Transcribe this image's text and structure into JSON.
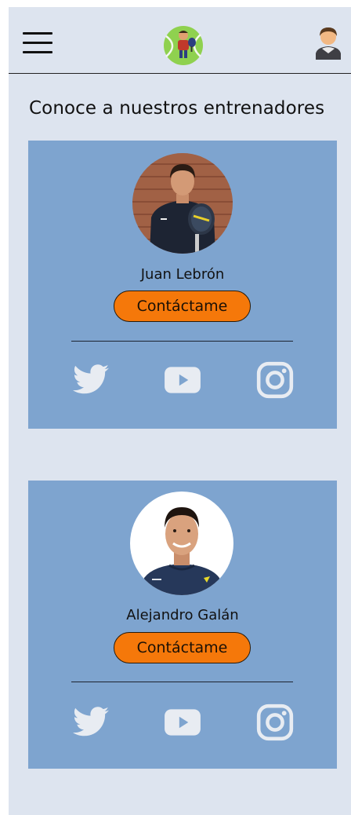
{
  "header": {
    "menu_icon": "hamburger-menu-icon",
    "logo_icon": "tennis-ball-logo",
    "user_icon": "user-avatar-icon"
  },
  "page": {
    "title": "Conoce a nuestros entrenadores"
  },
  "trainers": [
    {
      "name": "Juan Lebrón",
      "contact_label": "Contáctame",
      "photo_icon": "trainer-photo"
    },
    {
      "name": "Alejandro Galán",
      "contact_label": "Contáctame",
      "photo_icon": "trainer-photo"
    }
  ],
  "social_icons": [
    "twitter-icon",
    "youtube-icon",
    "instagram-icon"
  ],
  "colors": {
    "background": "#dde4ef",
    "card": "#7ea4cf",
    "button": "#f5780a",
    "social": "#e8ecf2",
    "logo_ball": "#8fd14f"
  }
}
